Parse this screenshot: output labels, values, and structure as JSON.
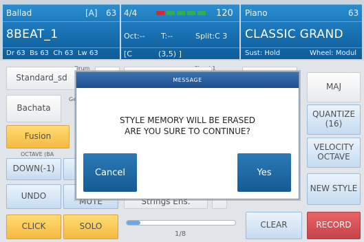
{
  "style_panel": {
    "name": "Ballad",
    "bank": "[A]",
    "number": "63",
    "title": "8BEAT_1",
    "volumes": "Dr 63  Bs 63  Ch 63  Lw 63"
  },
  "center_panel": {
    "time_signature": "4/4",
    "tempo": "120",
    "octave": "Oct:--",
    "transpose": "T:--",
    "split": "Split:C 3",
    "chord": "[C",
    "position": "(3,5) ]",
    "measure_indicator_colors": [
      "#e8202a",
      "#2bb24c",
      "#2bb24c",
      "#2bb24c",
      "#2bb24c"
    ]
  },
  "voice_panel": {
    "category": "Piano",
    "number": "63",
    "name": "CLASSIC GRAND",
    "sustain": "Sust: Hold",
    "wheel": "Wheel: Modul"
  },
  "left_buttons": {
    "drum_kit": "Standard_sd",
    "drum_tag": "Drum",
    "genre": "Bachata",
    "genre_tag": "Ge",
    "fusion": "Fusion",
    "octave_label": "OCTAVE (BA",
    "down": "DOWN(-1)",
    "undo": "UNDO",
    "mute": "MUTE",
    "click": "CLICK",
    "solo": "SOLO",
    "chord_tag": "Chord 1",
    "strings": "Strings Ens."
  },
  "right_buttons": {
    "maj": "MAJ",
    "quantize": "QUANTIZE (16)",
    "velocity": "VELOCITY OCTAVE",
    "new_style": "NEW STYLE",
    "clear": "CLEAR",
    "record": "RECORD"
  },
  "progress": {
    "label": "1/8",
    "fraction": 0.125
  },
  "dialog": {
    "header": "MESSAGE",
    "line1": "STYLE MEMORY WILL BE ERASED",
    "line2": "ARE YOU SURE TO CONTINUE?",
    "cancel": "Cancel",
    "yes": "Yes"
  },
  "colors": {
    "panel_blue": "#176fb0",
    "accent_orange": "#f2a60d",
    "record_red": "#b40f17"
  }
}
